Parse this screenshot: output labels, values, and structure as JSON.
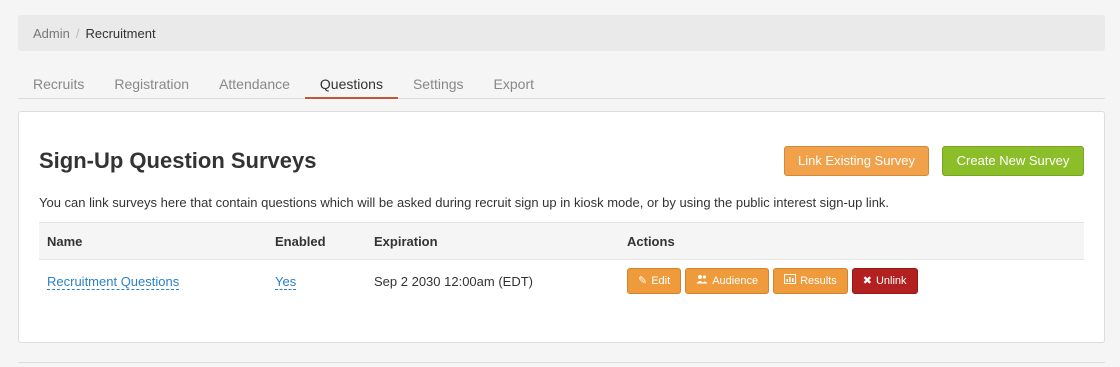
{
  "breadcrumb": {
    "root": "Admin",
    "separator": "/",
    "current": "Recruitment"
  },
  "tabs": [
    "Recruits",
    "Registration",
    "Attendance",
    "Questions",
    "Settings",
    "Export"
  ],
  "active_tab": "Questions",
  "panel": {
    "title": "Sign-Up Question Surveys",
    "link_button": "Link Existing Survey",
    "create_button": "Create New Survey",
    "description": "You can link surveys here that contain questions which will be asked during recruit sign up in kiosk mode, or by using the public interest sign-up link."
  },
  "table": {
    "headers": {
      "name": "Name",
      "enabled": "Enabled",
      "expiration": "Expiration",
      "actions": "Actions"
    },
    "rows": [
      {
        "name": "Recruitment Questions",
        "enabled": "Yes",
        "expiration": "Sep 2 2030 12:00am (EDT)"
      }
    ],
    "actions": {
      "edit": "Edit",
      "audience": "Audience",
      "results": "Results",
      "unlink": "Unlink"
    }
  },
  "colors": {
    "link_button": "#f0a14a",
    "create_button": "#8cbe2a",
    "action_orange": "#ef9b3c",
    "action_red": "#b32020",
    "link": "#2a82c8",
    "active_tab_underline": "#c0593a"
  },
  "icons": {
    "edit": "pencil-icon",
    "audience": "users-icon",
    "results": "bar-chart-icon",
    "unlink": "close-icon"
  }
}
